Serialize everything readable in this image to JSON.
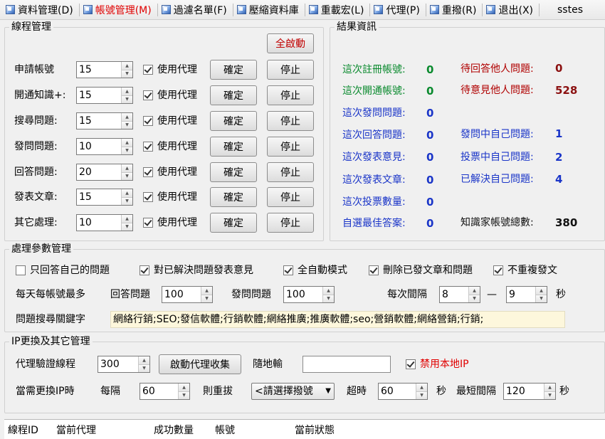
{
  "menu": {
    "items": [
      {
        "label": "資料管理(D)"
      },
      {
        "label": "帳號管理(M)"
      },
      {
        "label": "過濾名單(F)"
      },
      {
        "label": "壓縮資料庫"
      },
      {
        "label": "重載宏(L)"
      },
      {
        "label": "代理(P)"
      },
      {
        "label": "重撥(R)"
      },
      {
        "label": "退出(X)"
      }
    ],
    "overflow_text": "sstes"
  },
  "thread_mgmt": {
    "title": "線程管理",
    "start_all": "全啟動",
    "proxy_label": "使用代理",
    "confirm_label": "確定",
    "stop_label": "停止",
    "rows": [
      {
        "label": "申請帳號",
        "value": "15"
      },
      {
        "label": "開通知識+:",
        "value": "15"
      },
      {
        "label": "搜尋問題:",
        "value": "15"
      },
      {
        "label": "發問問題:",
        "value": "10"
      },
      {
        "label": "回答問題:",
        "value": "20"
      },
      {
        "label": "發表文章:",
        "value": "15"
      },
      {
        "label": "其它處理:",
        "value": "10"
      }
    ]
  },
  "results": {
    "title": "結果資訊",
    "left": [
      {
        "label": "這次註冊帳號:",
        "value": "0"
      },
      {
        "label": "這次開通帳號:",
        "value": "0"
      },
      {
        "label": "這次發問問題:",
        "value": "0"
      },
      {
        "label": "這次回答問題:",
        "value": "0"
      },
      {
        "label": "這次發表意見:",
        "value": "0"
      },
      {
        "label": "這次發表文章:",
        "value": "0"
      },
      {
        "label": "這次投票數量:",
        "value": "0"
      },
      {
        "label": "自選最佳答案:",
        "value": "0"
      }
    ],
    "right": {
      "pending_answer": {
        "label": "待回答他人問題:",
        "value": "0"
      },
      "pending_opinion": {
        "label": "待意見他人問題:",
        "value": "528"
      },
      "asking_self": {
        "label": "發問中自己問題:",
        "value": "1"
      },
      "voting_self": {
        "label": "投票中自己問題:",
        "value": "2"
      },
      "solved_self": {
        "label": "已解決自己問題:",
        "value": "4"
      },
      "expert_total": {
        "label": "知識家帳號總數:",
        "value": "380"
      }
    }
  },
  "params": {
    "title": "處理參數管理",
    "checks": [
      {
        "label": "只回答自己的問題",
        "checked": false
      },
      {
        "label": "對已解決問題發表意見",
        "checked": true
      },
      {
        "label": "全自動模式",
        "checked": true
      },
      {
        "label": "刪除已發文章和問題",
        "checked": true
      },
      {
        "label": "不重複發文",
        "checked": true
      }
    ],
    "daily_label": "每天每帳號最多",
    "answer_label": "回答問題",
    "answer_value": "100",
    "ask_label": "發問問題",
    "ask_value": "100",
    "interval_label": "每次間隔",
    "interval_min": "8",
    "interval_dash": "—",
    "interval_max": "9",
    "seconds_label": "秒",
    "keyword_label": "問題搜尋關鍵字",
    "keywords": "網絡行銷;SEO;發信軟體;行銷軟體;網絡推廣;推廣軟體;seo;營銷軟體;網絡營銷;行銷;"
  },
  "ip": {
    "title": "IP更換及其它管理",
    "verify_label": "代理驗證線程",
    "verify_value": "300",
    "collect_button": "啟動代理收集",
    "random_label": "隨地輸",
    "random_value": "",
    "disable_local_label": "禁用本地IP",
    "disable_local_checked": true,
    "when_label": "當需更換IP時",
    "every_label": "每隔",
    "every_value": "60",
    "redial_label": "則重拔",
    "dial_select": "<請選擇撥號",
    "timeout_label": "超時",
    "timeout_value": "60",
    "timeout_unit": "秒",
    "min_interval_label": "最短間隔",
    "min_interval_value": "120",
    "min_interval_unit": "秒"
  },
  "log_table": {
    "columns": [
      "線程ID",
      "當前代理",
      "成功數量",
      "帳號",
      "當前狀態"
    ]
  },
  "colors": {
    "active_menu": "#e00000",
    "green_value": "#0a8a2e",
    "blue_label": "#1a35c8",
    "red_label": "#b00000",
    "disable_local": "#e00000"
  }
}
